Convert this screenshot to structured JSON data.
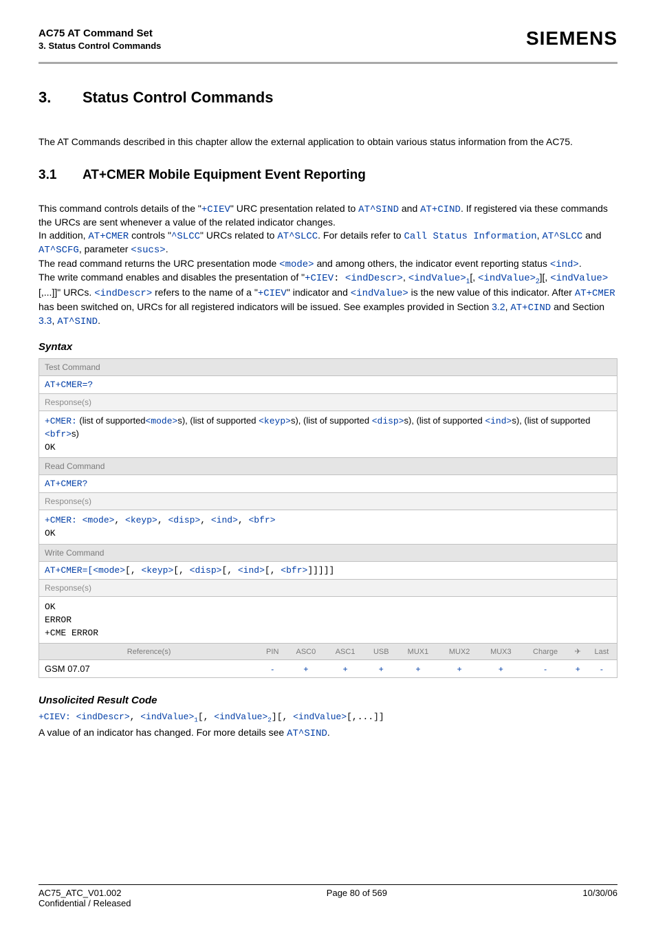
{
  "header": {
    "doc_title": "AC75 AT Command Set",
    "section_name": "3. Status Control Commands",
    "brand": "SIEMENS"
  },
  "chapter": {
    "num": "3.",
    "title": "Status Control Commands"
  },
  "intro": "The AT Commands described in this chapter allow the external application to obtain various status information from the AC75.",
  "section": {
    "num": "3.1",
    "title": "AT+CMER   Mobile Equipment Event Reporting"
  },
  "desc": {
    "l1a": "This command controls details of the \"",
    "l1b": "+CIEV",
    "l1c": "\" URC presentation related to ",
    "l1d": "AT^SIND",
    "l1e": " and ",
    "l1f": "AT+CIND",
    "l1g": ". If registered via these commands the URCs are sent whenever a value of the related indicator changes.",
    "l2a": "In addition, ",
    "l2b": "AT+CMER",
    "l2c": " controls \"",
    "l2d": "^SLCC",
    "l2e": "\" URCs related to ",
    "l2f": "AT^SLCC",
    "l2g": ". For details refer to ",
    "l2h": "Call Status Information",
    "l2i": ", ",
    "l2j": "AT^SLCC",
    "l2k": " and ",
    "l2l": "AT^SCFG",
    "l2m": ", parameter ",
    "l2n": "<sucs>",
    "l2o": ".",
    "l3a": "The read command returns the URC presentation mode ",
    "l3b": "<mode>",
    "l3c": " and among others, the indicator event reporting status ",
    "l3d": "<ind>",
    "l3e": ".",
    "l4a": "The write command enables and disables the presentation of \"",
    "l4b": "+CIEV",
    "l4c": ": ",
    "l4d": "<indDescr>",
    "l4e": ", ",
    "l4f": "<indValue>",
    "l4g": "1",
    "l4h": "[, ",
    "l4i": "<indValue>",
    "l4j": "2",
    "l4k": "][, ",
    "l4l": "<indValue>",
    "l4m": "[,...]]\" URCs. ",
    "l4n": "<indDescr>",
    "l4o": " refers to the name of a \"",
    "l4p": "+CIEV",
    "l4q": "\" indicator and ",
    "l4r": "<indValue>",
    "l4s": " is the new value of this indicator. After ",
    "l4t": "AT+CMER",
    "l4u": " has been switched on, URCs for all registered indicators will be issued. See examples provided in Section ",
    "l4v": "3.2",
    "l4w": ", ",
    "l4x": "AT+CIND",
    "l4y": " and Section ",
    "l4z": "3.3",
    "l4za": ", ",
    "l4zb": "AT^SIND",
    "l4zc": "."
  },
  "syntax_h": "Syntax",
  "tbl": {
    "test_lbl": "Test Command",
    "test_cmd": "AT+CMER=?",
    "resp_lbl": "Response(s)",
    "test_resp": {
      "a": "+CMER:",
      "b": " (list of supported",
      "c": "<mode>",
      "d": "s), (list of supported ",
      "e": "<keyp>",
      "f": "s), (list of supported ",
      "g": "<disp>",
      "h": "s), (list of supported ",
      "i": "<ind>",
      "j": "s), (list of supported ",
      "k": "<bfr>",
      "l": "s)",
      "ok": "OK"
    },
    "read_lbl": "Read Command",
    "read_cmd": "AT+CMER?",
    "read_resp": {
      "a": "+CMER: ",
      "b": "<mode>",
      "c": ", ",
      "d": "<keyp>",
      "e": ", ",
      "f": "<disp>",
      "g": ", ",
      "h": "<ind>",
      "i": ", ",
      "j": "<bfr>",
      "ok": "OK"
    },
    "write_lbl": "Write Command",
    "write_cmd": {
      "a": "AT+CMER=[",
      "b": "<mode>",
      "c": "[, ",
      "d": "<keyp>",
      "e": "[, ",
      "f": "<disp>",
      "g": "[, ",
      "h": "<ind>",
      "i": "[, ",
      "j": "<bfr>",
      "k": "]]]]]"
    },
    "write_resp": {
      "ok": "OK",
      "err": "ERROR",
      "cme": "+CME ERROR"
    },
    "ref_lbl": "Reference(s)",
    "ref_val": "GSM 07.07",
    "cols": {
      "pin": "PIN",
      "asc0": "ASC0",
      "asc1": "ASC1",
      "usb": "USB",
      "mux1": "MUX1",
      "mux2": "MUX2",
      "mux3": "MUX3",
      "chg": "Charge",
      "plane": "✈",
      "last": "Last"
    },
    "vals": {
      "pin": "-",
      "asc0": "+",
      "asc1": "+",
      "usb": "+",
      "mux1": "+",
      "mux2": "+",
      "mux3": "+",
      "chg": "-",
      "plane": "+",
      "last": "-"
    }
  },
  "urc": {
    "heading": "Unsolicited Result Code",
    "code": {
      "a": "+CIEV: ",
      "b": "<indDescr>",
      "c": ", ",
      "d": "<indValue>",
      "e": "1",
      "f": "[, ",
      "g": "<indValue>",
      "h": "2",
      "i": "][, ",
      "j": "<indValue>",
      "k": "[,...]]"
    },
    "txt_a": "A value of an indicator has changed. For more details see ",
    "txt_b": "AT^SIND",
    "txt_c": "."
  },
  "footer": {
    "left1": "AC75_ATC_V01.002",
    "left2": "Confidential / Released",
    "center": "Page 80 of 569",
    "right": "10/30/06"
  }
}
